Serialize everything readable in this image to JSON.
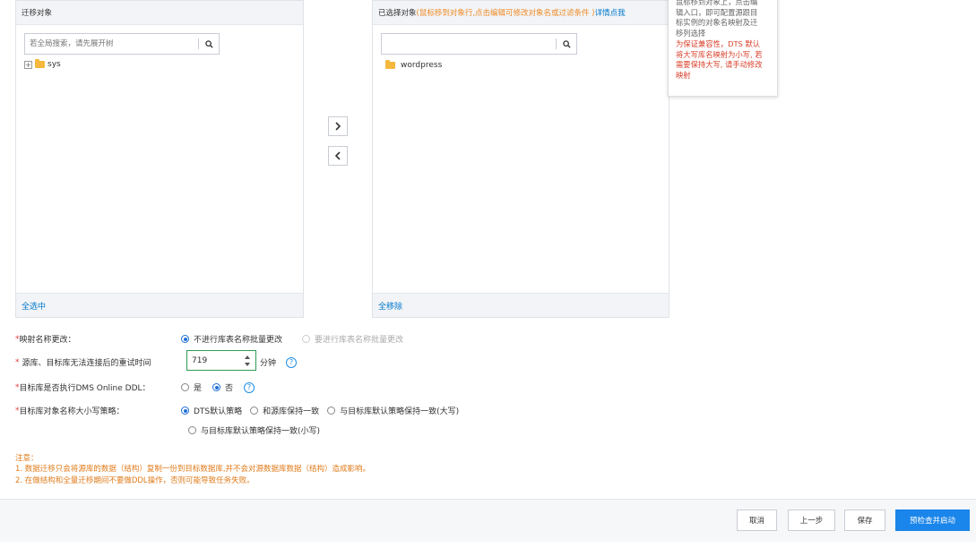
{
  "source_panel": {
    "title": "迁移对象",
    "search_placeholder": "若全局搜索，请先展开树",
    "tree": [
      {
        "expand": "+",
        "label": "sys"
      }
    ],
    "footer_link": "全选中"
  },
  "target_panel": {
    "title": "已选择对象",
    "hint": "(鼠标移到对象行,点击编辑可修改对象名或过滤条件 )",
    "detail_link": "详情点我",
    "search_placeholder": "",
    "items": [
      {
        "label": "wordpress"
      }
    ],
    "footer_link": "全移除"
  },
  "transfer": {
    "add": "›",
    "remove": "‹"
  },
  "tooltip": {
    "muted_lines": [
      "鼠标移到对象上，点击编",
      "辑入口，即可配置源跟目",
      "标实例的对象名映射及迁",
      "移列选择"
    ],
    "warn_lines": [
      "为保证兼容性，DTS 默认",
      "将大写库名映射为小写, 若",
      "需要保持大写, 请手动修改",
      "映射"
    ]
  },
  "form": {
    "mapping": {
      "label": "映射名称更改：",
      "options": [
        {
          "label": "不进行库表名称批量更改",
          "selected": true,
          "disabled": false
        },
        {
          "label": "要进行库表名称批量更改",
          "selected": false,
          "disabled": true
        }
      ]
    },
    "retry": {
      "label": "源库、目标库无法连接后的重试时间",
      "value": "719",
      "unit": "分钟",
      "help": "?"
    },
    "ddl": {
      "label": "目标库是否执行DMS Online DDL：",
      "options": [
        {
          "label": "是",
          "selected": false
        },
        {
          "label": "否",
          "selected": true
        }
      ],
      "help": "?"
    },
    "case": {
      "label": "目标库对象名称大小写策略：",
      "options": [
        {
          "label": "DTS默认策略",
          "selected": true
        },
        {
          "label": "和源库保持一致",
          "selected": false
        },
        {
          "label": "与目标库默认策略保持一致(大写)",
          "selected": false
        },
        {
          "label": "与目标库默认策略保持一致(小写)",
          "selected": false
        }
      ]
    }
  },
  "notice": {
    "title": "注意：",
    "lines": [
      "1. 数据迁移只会将源库的数据（结构）复制一份到目标数据库,并不会对源数据库数据（结构）造成影响。",
      "2. 在做结构和全量迁移期间不要做DDL操作，否则可能导致任务失败。"
    ]
  },
  "footer": {
    "cancel": "取消",
    "prev": "上一步",
    "save": "保存",
    "precheck": "预检查并启动"
  },
  "colors": {
    "primary": "#1a85ea",
    "warning": "#e07b1a",
    "required": "#e4393c",
    "link": "#0077cc"
  }
}
